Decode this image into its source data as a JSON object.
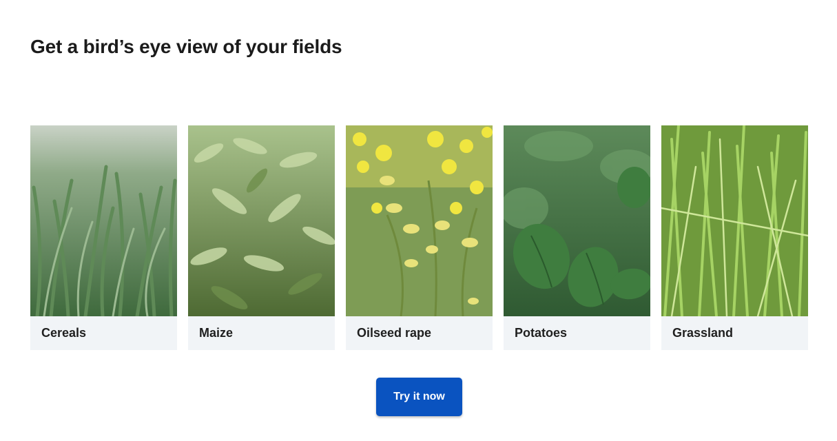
{
  "section": {
    "heading": "Get a bird’s eye view of your fields"
  },
  "crops": [
    {
      "label": "Cereals",
      "image": "wheat-field-photo",
      "tone": "#6f9a63"
    },
    {
      "label": "Maize",
      "image": "maize-field-photo",
      "tone": "#7fa258"
    },
    {
      "label": "Oilseed rape",
      "image": "rapeseed-flowers-photo",
      "tone": "#e6e04a"
    },
    {
      "label": "Potatoes",
      "image": "potato-leaves-photo",
      "tone": "#3f7a3f"
    },
    {
      "label": "Grassland",
      "image": "grass-photo",
      "tone": "#8cc04e"
    }
  ],
  "cta": {
    "label": "Try it now",
    "color": "#0a53c0"
  }
}
